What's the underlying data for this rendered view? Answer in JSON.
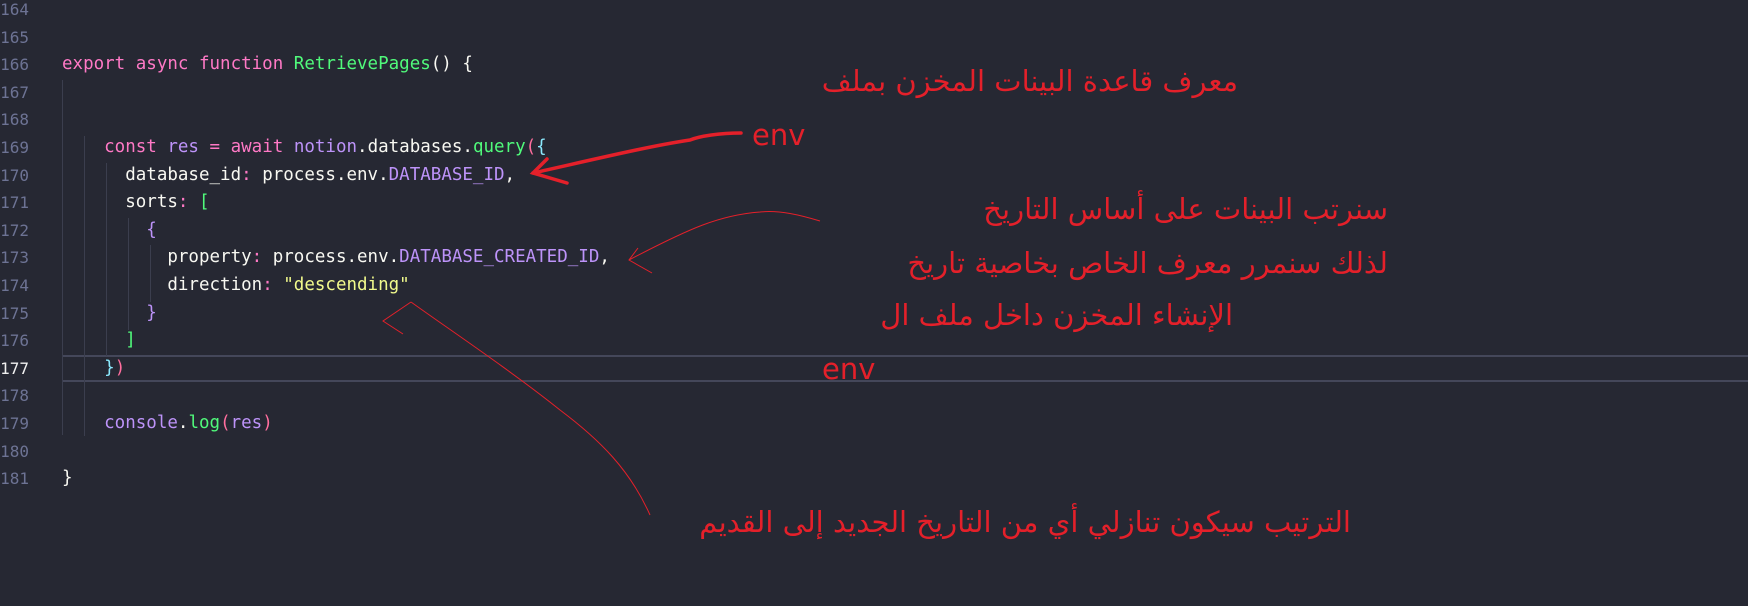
{
  "editor": {
    "current_line": 177,
    "lines": [
      {
        "n": 164,
        "tokens": []
      },
      {
        "n": 165,
        "tokens": []
      },
      {
        "n": 166,
        "tokens": [
          {
            "t": "export async function ",
            "c": "kw"
          },
          {
            "t": "RetrievePages",
            "c": "fn"
          },
          {
            "t": "() {",
            "c": "pl"
          }
        ]
      },
      {
        "n": 167,
        "tokens": []
      },
      {
        "n": 168,
        "tokens": []
      },
      {
        "n": 169,
        "tokens": [
          {
            "t": "    const ",
            "c": "kw"
          },
          {
            "t": "res ",
            "c": "ob"
          },
          {
            "t": "= ",
            "c": "pu"
          },
          {
            "t": "await ",
            "c": "kw"
          },
          {
            "t": "notion",
            "c": "ob"
          },
          {
            "t": ".databases.",
            "c": "pl"
          },
          {
            "t": "query",
            "c": "fn"
          },
          {
            "t": "(",
            "c": "bp"
          },
          {
            "t": "{",
            "c": "b2"
          }
        ]
      },
      {
        "n": 170,
        "tokens": [
          {
            "t": "      database_id",
            "c": "pl"
          },
          {
            "t": ": ",
            "c": "pu"
          },
          {
            "t": "process.env.",
            "c": "pl"
          },
          {
            "t": "DATABASE_ID",
            "c": "cn"
          },
          {
            "t": ",",
            "c": "pl"
          }
        ]
      },
      {
        "n": 171,
        "tokens": [
          {
            "t": "      sorts",
            "c": "pl"
          },
          {
            "t": ": ",
            "c": "pu"
          },
          {
            "t": "[",
            "c": "b4"
          }
        ]
      },
      {
        "n": 172,
        "tokens": [
          {
            "t": "        {",
            "c": "b3"
          }
        ]
      },
      {
        "n": 173,
        "tokens": [
          {
            "t": "          property",
            "c": "pl"
          },
          {
            "t": ": ",
            "c": "pu"
          },
          {
            "t": "process.env.",
            "c": "pl"
          },
          {
            "t": "DATABASE_CREATED_ID",
            "c": "cn"
          },
          {
            "t": ",",
            "c": "pl"
          }
        ]
      },
      {
        "n": 174,
        "tokens": [
          {
            "t": "          direction",
            "c": "pl"
          },
          {
            "t": ": ",
            "c": "pu"
          },
          {
            "t": "\"descending\"",
            "c": "st"
          }
        ]
      },
      {
        "n": 175,
        "tokens": [
          {
            "t": "        }",
            "c": "b3"
          }
        ]
      },
      {
        "n": 176,
        "tokens": [
          {
            "t": "      ]",
            "c": "b4"
          }
        ]
      },
      {
        "n": 177,
        "tokens": [
          {
            "t": "    }",
            "c": "b2"
          },
          {
            "t": ")",
            "c": "bp"
          }
        ]
      },
      {
        "n": 178,
        "tokens": []
      },
      {
        "n": 179,
        "tokens": [
          {
            "t": "    console",
            "c": "ob"
          },
          {
            "t": ".",
            "c": "pl"
          },
          {
            "t": "log",
            "c": "fn"
          },
          {
            "t": "(",
            "c": "bp"
          },
          {
            "t": "res",
            "c": "ob"
          },
          {
            "t": ")",
            "c": "bp"
          }
        ]
      },
      {
        "n": 180,
        "tokens": []
      },
      {
        "n": 181,
        "tokens": [
          {
            "t": "}",
            "c": "pl"
          }
        ]
      }
    ]
  },
  "annotations": {
    "database_id_note": "معرف قاعدة البينات المخزن بملف",
    "database_id_env": "env",
    "created_id_line1": "سنرتب البينات على أساس التاريخ",
    "created_id_line2": "لذلك سنمرر معرف الخاص بخاصية تاريخ",
    "created_id_line3": "الإنشاء المخزن داخل ملف ال",
    "created_id_env": "env",
    "direction_note": "الترتيب سيكون تنازلي أي من التاريخ الجديد إلى القديم"
  },
  "colors": {
    "background": "#262833",
    "annotation": "#e4202a"
  }
}
